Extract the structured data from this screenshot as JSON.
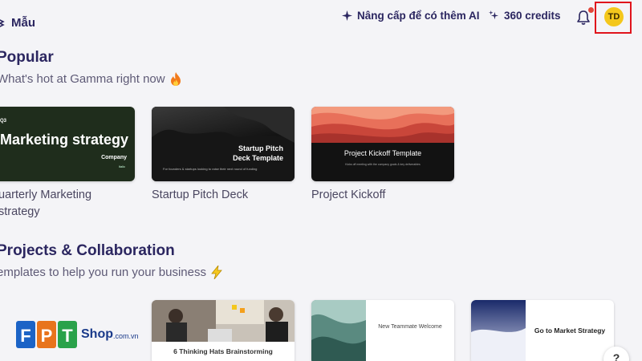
{
  "header": {
    "breadcrumb": "Mẫu",
    "upgrade_label": "Nâng cấp để có thêm AI",
    "credits_label": "360 credits",
    "avatar_initials": "TD"
  },
  "sections": [
    {
      "title": "Popular",
      "subtitle": "What's hot at Gamma right now",
      "cards": [
        {
          "label": "uarterly Marketing strategy",
          "thumb": {
            "q": "Q3",
            "title": "Marketing strategy",
            "company": "Company",
            "co_sub": "Italic"
          }
        },
        {
          "label": "Startup Pitch Deck",
          "thumb": {
            "title": "Startup Pitch Deck Template",
            "sub": "For founders & startups looking to raise their next round of funding"
          }
        },
        {
          "label": "Project Kickoff",
          "thumb": {
            "title": "Project Kickoff Template",
            "sub": "Kicks off meeting with the company goals & key deliverables"
          }
        }
      ]
    },
    {
      "title": "Projects & Collaboration",
      "subtitle": "emplates to help you run your business",
      "cards": [
        {
          "thumb": {
            "title": "6 Thinking Hats Brainstorming"
          }
        },
        {
          "thumb": {
            "title": "New Teammate Welcome"
          }
        },
        {
          "thumb": {
            "title": "Go to Market Strategy"
          }
        }
      ]
    }
  ],
  "help_label": "?",
  "watermark": {
    "letters": "FPT",
    "shop": "Shop",
    "domain": ".com.vn"
  },
  "colors": {
    "accent": "#2b2660",
    "avatar": "#f4c71c",
    "highlight_frame": "#e0141c",
    "notification": "#e2473b"
  }
}
